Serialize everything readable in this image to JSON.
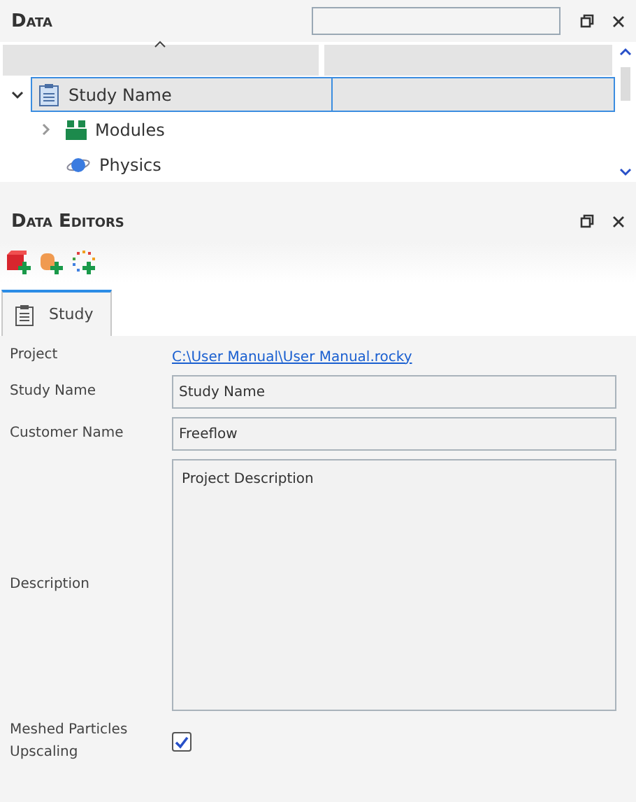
{
  "data_panel": {
    "title": "Data",
    "tree": [
      {
        "label": "Study Name",
        "kind": "study",
        "expanded": true,
        "selected": true,
        "children": [
          {
            "label": "Modules",
            "kind": "modules",
            "expanded": false,
            "selected": false
          },
          {
            "label": "Physics",
            "kind": "physics",
            "selected": false
          }
        ]
      }
    ]
  },
  "editors_panel": {
    "title": "Data Editors",
    "toolbar": [
      {
        "kind": "cube"
      },
      {
        "kind": "cylinder"
      },
      {
        "kind": "particles"
      }
    ],
    "tabs": [
      {
        "label": "Study",
        "selected": true
      }
    ],
    "fields": [
      {
        "kind": "link",
        "label": "Project",
        "value": "C:\\User Manual\\User Manual.rocky"
      },
      {
        "kind": "text",
        "label": "Study Name",
        "value": "Study Name"
      },
      {
        "kind": "text",
        "label": "Customer Name",
        "value": "Freeflow"
      },
      {
        "kind": "textarea",
        "label": "Description",
        "value": "Project Description"
      },
      {
        "kind": "checkbox",
        "label": "Meshed Particles Upscaling",
        "checked": true
      }
    ]
  }
}
